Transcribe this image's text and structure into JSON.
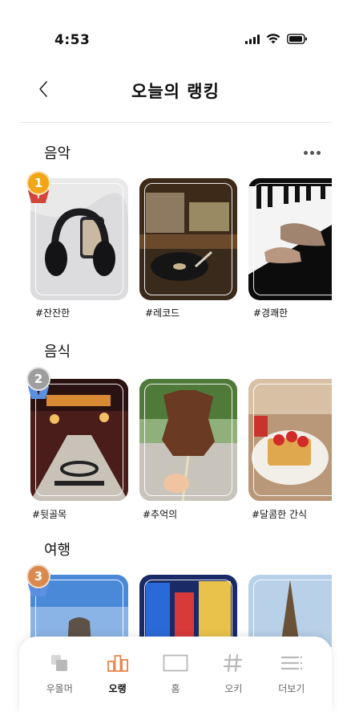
{
  "status": {
    "time": "4:53"
  },
  "header": {
    "title": "오늘의 랭킹"
  },
  "sections": [
    {
      "title": "음악",
      "rank": "1",
      "medal_color": "#f2a516",
      "ribbon_color": "#d2453a",
      "cards": [
        {
          "label": "#잔잔한",
          "scene": "headphones"
        },
        {
          "label": "#레코드",
          "scene": "turntable"
        },
        {
          "label": "#경쾌한",
          "scene": "piano"
        }
      ]
    },
    {
      "title": "음식",
      "rank": "2",
      "medal_color": "#9e9e9e",
      "ribbon_color": "#5b8fe0",
      "cards": [
        {
          "label": "#뒷골목",
          "scene": "alley"
        },
        {
          "label": "#추억의",
          "scene": "snack"
        },
        {
          "label": "#달콤한 간식",
          "scene": "dessert"
        }
      ]
    },
    {
      "title": "여행",
      "rank": "3",
      "medal_color": "#d98a4d",
      "ribbon_color": "#5b8fe0",
      "cards": [
        {
          "label": "",
          "scene": "statue"
        },
        {
          "label": "",
          "scene": "city-night"
        },
        {
          "label": "",
          "scene": "eiffel"
        }
      ]
    }
  ],
  "tabbar": {
    "active_color": "#e8844a",
    "inactive_color": "#b9b9b9",
    "tabs": [
      {
        "label": "우올머",
        "icon": "cards-icon"
      },
      {
        "label": "오랭",
        "icon": "bar-chart-icon",
        "active": true
      },
      {
        "label": "홈",
        "icon": "home-square-icon"
      },
      {
        "label": "오키",
        "icon": "hashtag-icon"
      },
      {
        "label": "더보기",
        "icon": "menu-more-icon"
      }
    ]
  }
}
